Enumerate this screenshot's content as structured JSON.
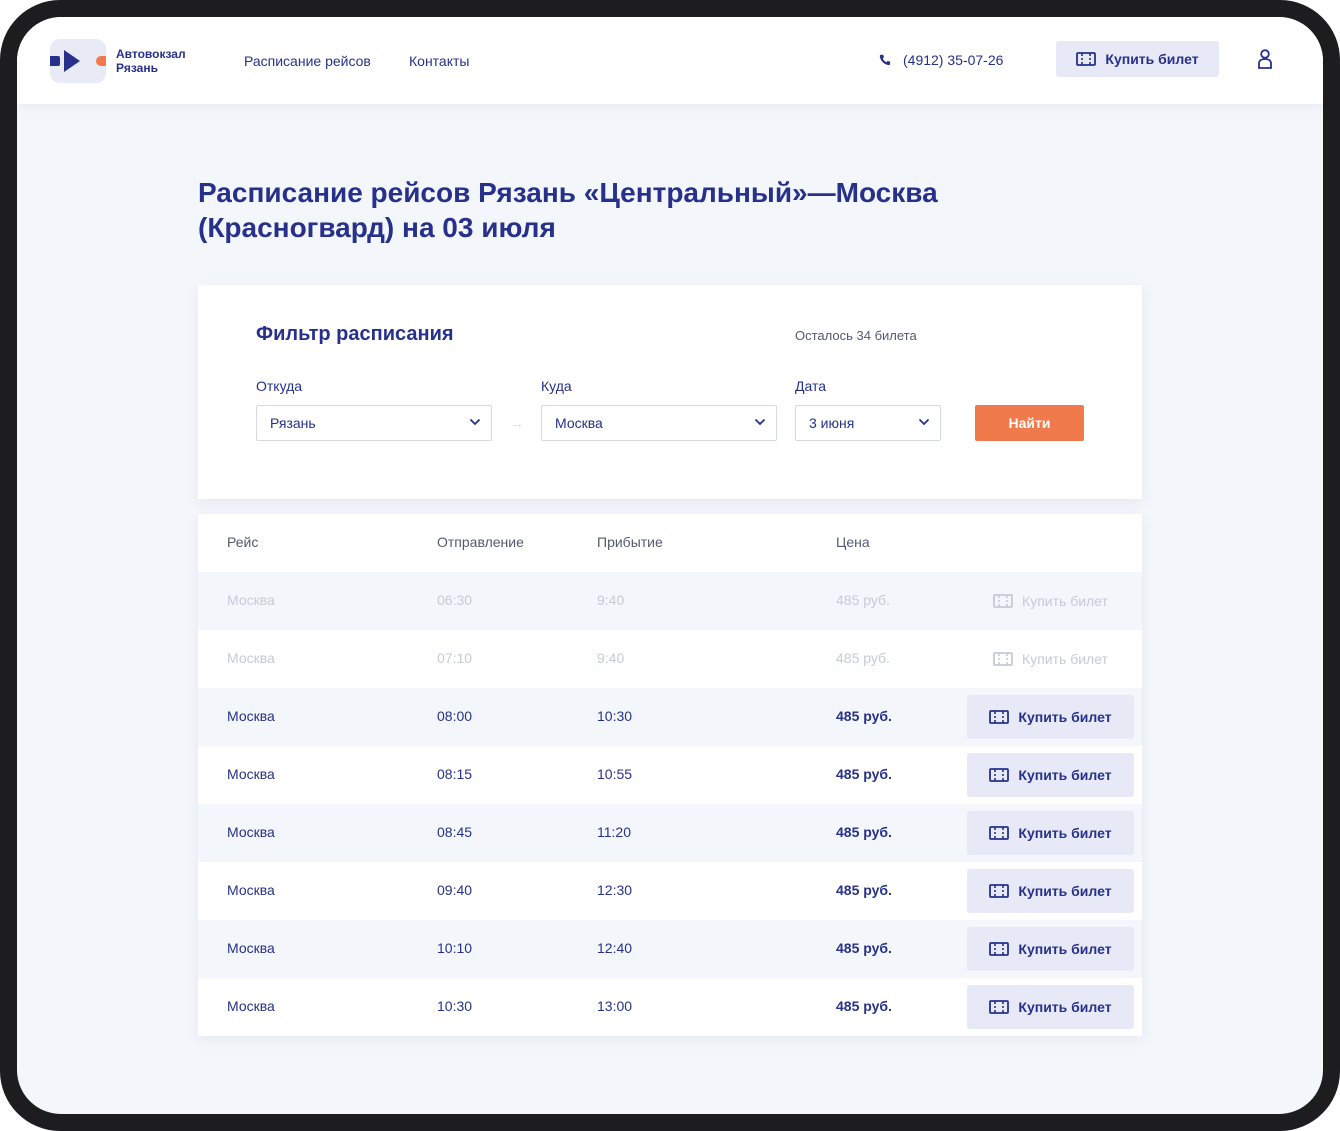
{
  "header": {
    "logo_text": "Автовокзал Рязань",
    "nav": [
      "Расписание рейсов",
      "Контакты"
    ],
    "phone": "(4912) 35-07-26",
    "buy_label": "Купить билет"
  },
  "page_title": "Расписание рейсов Рязань «Центральный»—Москва (Красногвард) на 03 июля",
  "filter": {
    "title": "Фильтр расписания",
    "tickets_left": "Осталось 34 билета",
    "from_label": "Откуда",
    "from_value": "Рязань",
    "to_label": "Куда",
    "to_value": "Москва",
    "date_label": "Дата",
    "date_value": "3 июня",
    "find_label": "Найти",
    "arrow": "→"
  },
  "table": {
    "columns": [
      "Рейс",
      "Отправление",
      "Прибытие",
      "Цена"
    ],
    "rows": [
      {
        "route": "Москва",
        "departure": "06:30",
        "arrival": "9:40",
        "price": "485 руб.",
        "buy": "Купить билет",
        "disabled": true
      },
      {
        "route": "Москва",
        "departure": "07:10",
        "arrival": "9:40",
        "price": "485 руб.",
        "buy": "Купить билет",
        "disabled": true
      },
      {
        "route": "Москва",
        "departure": "08:00",
        "arrival": "10:30",
        "price": "485 руб.",
        "buy": "Купить билет",
        "disabled": false
      },
      {
        "route": "Москва",
        "departure": "08:15",
        "arrival": "10:55",
        "price": "485 руб.",
        "buy": "Купить билет",
        "disabled": false
      },
      {
        "route": "Москва",
        "departure": "08:45",
        "arrival": "11:20",
        "price": "485 руб.",
        "buy": "Купить билет",
        "disabled": false
      },
      {
        "route": "Москва",
        "departure": "09:40",
        "arrival": "12:30",
        "price": "485 руб.",
        "buy": "Купить билет",
        "disabled": false
      },
      {
        "route": "Москва",
        "departure": "10:10",
        "arrival": "12:40",
        "price": "485 руб.",
        "buy": "Купить билет",
        "disabled": false
      },
      {
        "route": "Москва",
        "departure": "10:30",
        "arrival": "13:00",
        "price": "485 руб.",
        "buy": "Купить билет",
        "disabled": false
      }
    ]
  },
  "colors": {
    "primary": "#27318b",
    "accent": "#f07a4c",
    "button_bg": "#e7eaf6",
    "page_bg": "#f3f6fa",
    "disabled_text": "#c6cad6"
  },
  "icons": [
    "logo-mark",
    "phone-icon",
    "ticket-icon",
    "user-icon",
    "chevron-down-icon"
  ]
}
